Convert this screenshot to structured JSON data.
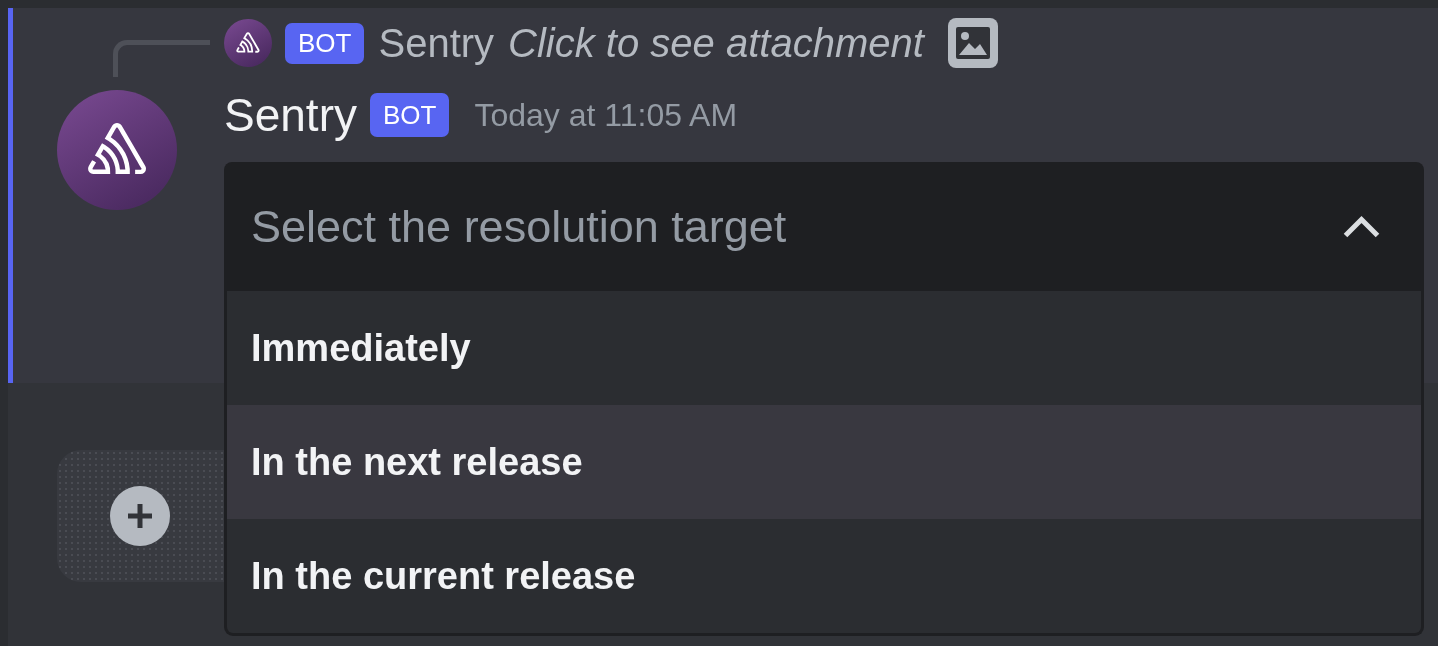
{
  "reply": {
    "author": "Sentry",
    "badge": "BOT",
    "preview": "Click to see attachment"
  },
  "message": {
    "author": "Sentry",
    "badge": "BOT",
    "timestamp": "Today at 11:05 AM"
  },
  "select_menu": {
    "placeholder": "Select the resolution target",
    "expanded": true,
    "options": [
      {
        "label": "Immediately",
        "selected": false
      },
      {
        "label": "In the next release",
        "selected": true
      },
      {
        "label": "In the current release",
        "selected": false
      }
    ]
  }
}
